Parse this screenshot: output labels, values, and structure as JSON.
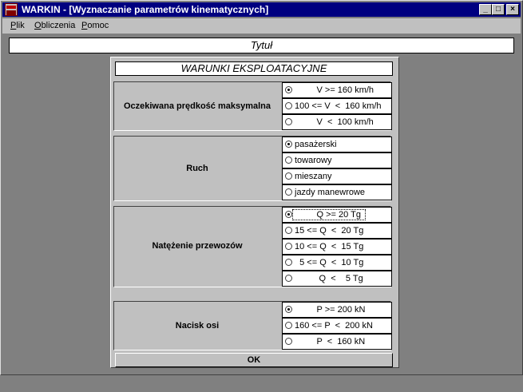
{
  "window": {
    "title": "WARKIN - [Wyznaczanie parametrów kinematycznych]",
    "buttons": [
      "_",
      "□",
      "×"
    ]
  },
  "menu": {
    "items": [
      {
        "hotkey": "P",
        "rest": "lik"
      },
      {
        "hotkey": "O",
        "rest": "bliczenia"
      },
      {
        "hotkey": "P",
        "rest": "omoc"
      }
    ]
  },
  "title_field": "Tytuł",
  "form": {
    "title": "WARUNKI EKSPLOATACYJNE",
    "groups": [
      {
        "label": "Oczekiwana prędkość maksymalna",
        "options": [
          {
            "text": "         V >= 160 km/h",
            "selected": true
          },
          {
            "text": "100 <= V  <  160 km/h",
            "selected": false
          },
          {
            "text": "         V  <  100 km/h",
            "selected": false
          }
        ]
      },
      {
        "label": "Ruch",
        "options": [
          {
            "text": "pasażerski",
            "selected": true
          },
          {
            "text": "towarowy",
            "selected": false
          },
          {
            "text": "mieszany",
            "selected": false
          },
          {
            "text": "jazdy manewrowe",
            "selected": false
          }
        ]
      },
      {
        "label": "Natężenie przewozów",
        "options": [
          {
            "text": "         Q >= 20 Tg",
            "selected": true
          },
          {
            "text": "15 <= Q  <  20 Tg",
            "selected": false
          },
          {
            "text": "10 <= Q  <  15 Tg",
            "selected": false
          },
          {
            "text": "  5 <= Q  <  10 Tg",
            "selected": false
          },
          {
            "text": "          Q  <    5 Tg",
            "selected": false
          }
        ]
      },
      {
        "label": "Nacisk osi",
        "options": [
          {
            "text": "         P >= 200 kN",
            "selected": true
          },
          {
            "text": "160 <= P  <  200 kN",
            "selected": false
          },
          {
            "text": "         P  <  160 kN",
            "selected": false
          }
        ]
      }
    ],
    "ok_label": "OK"
  }
}
